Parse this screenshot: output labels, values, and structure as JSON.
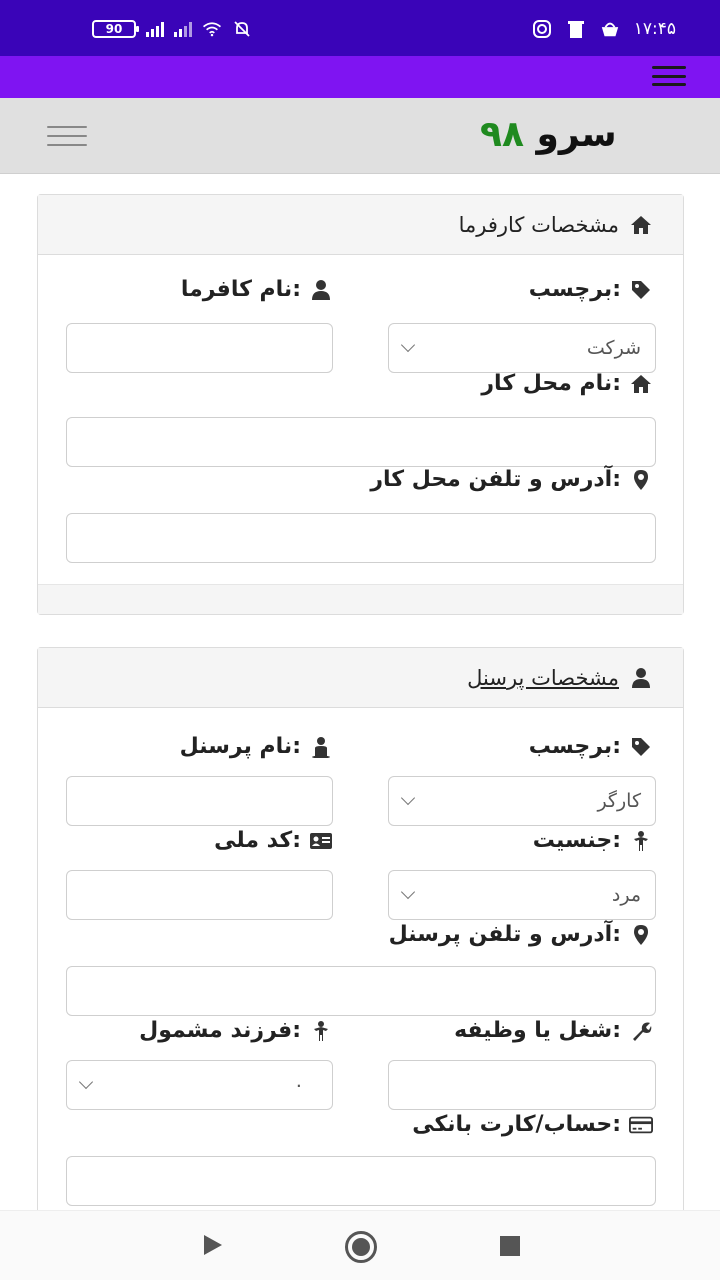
{
  "status_bar": {
    "battery": "90",
    "time": "۱۷:۴۵",
    "icons": [
      "battery-icon",
      "signal-icon",
      "signal-icon-2",
      "wifi-icon",
      "bell-off-icon",
      "instagram-icon",
      "trash-icon",
      "basket-icon"
    ]
  },
  "header": {
    "logo_word": "سرو",
    "logo_number": "۹۸",
    "logo_number_color": "#1f8a1f"
  },
  "employer_section": {
    "title": "مشخصات کارفرما",
    "tag_label": "برچسب:",
    "tag_value": "شرکت",
    "employer_name_label": "نام کافرما:",
    "employer_name_value": "",
    "workplace_name_label": "نام محل کار:",
    "workplace_name_value": "",
    "workplace_address_label": "آدرس و تلفن محل کار:",
    "workplace_address_value": ""
  },
  "personnel_section": {
    "title": "مشخصات پرسنل",
    "tag_label": "برچسب:",
    "tag_value": "کارگر",
    "name_label": "نام پرسنل:",
    "name_value": "",
    "gender_label": "جنسیت:",
    "gender_value": "مرد",
    "national_code_label": "کد ملی:",
    "national_code_value": "",
    "address_label": "آدرس و تلفن پرسنل:",
    "address_value": "",
    "job_label": "شغل یا وظیفه:",
    "job_value": "",
    "dependent_child_label": "فرزند مشمول:",
    "dependent_child_value": "۰",
    "bank_label": "حساب/کارت بانکی:",
    "bank_value": ""
  },
  "colors": {
    "status_bar": "#3a04b8",
    "app_bar": "#7f14f2",
    "header_bg": "#e0e0e0"
  }
}
